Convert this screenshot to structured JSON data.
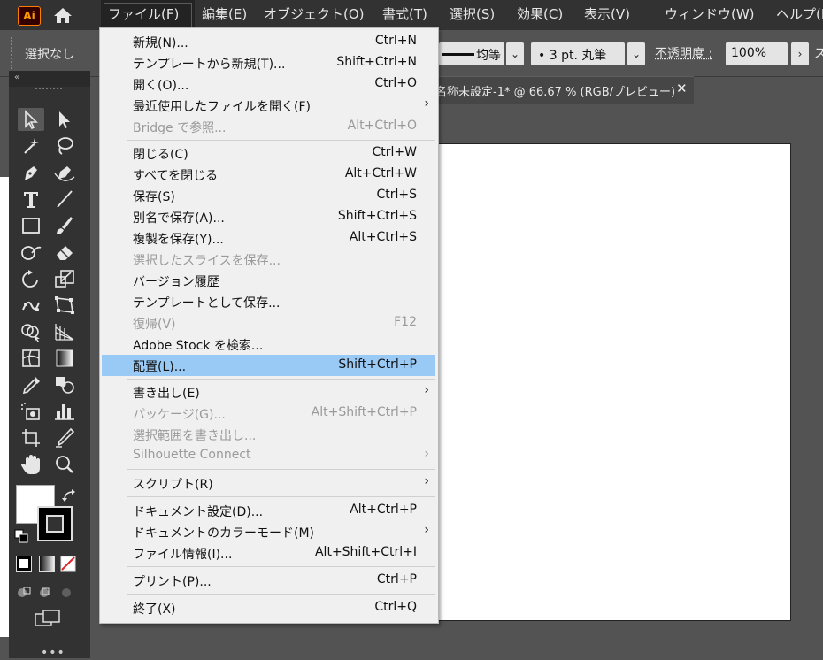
{
  "app": {
    "logo_text": "Ai",
    "home_icon": "home-icon"
  },
  "menubar": {
    "items": [
      "ファイル(F)",
      "編集(E)",
      "オブジェクト(O)",
      "書式(T)",
      "選択(S)",
      "効果(C)",
      "表示(V)",
      "ウィンドウ(W)",
      "ヘルプ(H)"
    ],
    "active": "ファイル(F)"
  },
  "control_bar": {
    "selection_label": "選択なし",
    "stroke_profile": "均等",
    "brush": "• 3 pt. 丸筆",
    "opacity_label": "不透明度 :",
    "opacity_value": "100%",
    "style_label": "ス"
  },
  "document_tab": {
    "title": "名称未設定-1* @ 66.67 % (RGB/プレビュー)",
    "close_icon": "close-icon"
  },
  "file_menu": {
    "items": [
      {
        "label": "新規(N)...",
        "shortcut": "Ctrl+N"
      },
      {
        "label": "テンプレートから新規(T)...",
        "shortcut": "Shift+Ctrl+N"
      },
      {
        "label": "開く(O)...",
        "shortcut": "Ctrl+O"
      },
      {
        "label": "最近使用したファイルを開く(F)",
        "shortcut": "",
        "submenu": true
      },
      {
        "label": "Bridge で参照...",
        "shortcut": "Alt+Ctrl+O",
        "disabled": true
      },
      {
        "label": "閉じる(C)",
        "shortcut": "Ctrl+W"
      },
      {
        "label": "すべてを閉じる",
        "shortcut": "Alt+Ctrl+W"
      },
      {
        "label": "保存(S)",
        "shortcut": "Ctrl+S"
      },
      {
        "label": "別名で保存(A)...",
        "shortcut": "Shift+Ctrl+S"
      },
      {
        "label": "複製を保存(Y)...",
        "shortcut": "Alt+Ctrl+S"
      },
      {
        "label": "選択したスライスを保存...",
        "shortcut": "",
        "disabled": true
      },
      {
        "label": "バージョン履歴",
        "shortcut": ""
      },
      {
        "label": "テンプレートとして保存...",
        "shortcut": ""
      },
      {
        "label": "復帰(V)",
        "shortcut": "F12",
        "disabled": true
      },
      {
        "label": "Adobe Stock を検索...",
        "shortcut": ""
      },
      {
        "label": "配置(L)...",
        "shortcut": "Shift+Ctrl+P",
        "highlighted": true
      },
      {
        "label": "書き出し(E)",
        "shortcut": "",
        "submenu": true
      },
      {
        "label": "パッケージ(G)...",
        "shortcut": "Alt+Shift+Ctrl+P",
        "disabled": true
      },
      {
        "label": "選択範囲を書き出し...",
        "shortcut": "",
        "disabled": true
      },
      {
        "label": "Silhouette Connect",
        "shortcut": "",
        "disabled": true,
        "submenu": true
      },
      {
        "label": "スクリプト(R)",
        "shortcut": "",
        "submenu": true
      },
      {
        "label": "ドキュメント設定(D)...",
        "shortcut": "Alt+Ctrl+P"
      },
      {
        "label": "ドキュメントのカラーモード(M)",
        "shortcut": "",
        "submenu": true
      },
      {
        "label": "ファイル情報(I)...",
        "shortcut": "Alt+Shift+Ctrl+I"
      },
      {
        "label": "プリント(P)...",
        "shortcut": "Ctrl+P"
      },
      {
        "label": "終了(X)",
        "shortcut": "Ctrl+Q"
      }
    ]
  },
  "toolbar": {
    "tools": [
      "selection-tool-icon",
      "direct-selection-tool-icon",
      "magic-wand-tool-icon",
      "lasso-tool-icon",
      "pen-tool-icon",
      "curvature-tool-icon",
      "type-tool-icon",
      "line-segment-tool-icon",
      "rectangle-tool-icon",
      "paintbrush-tool-icon",
      "shaper-tool-icon",
      "eraser-tool-icon",
      "rotate-tool-icon",
      "scale-tool-icon",
      "puppet-warp-tool-icon",
      "free-transform-tool-icon",
      "shape-builder-tool-icon",
      "perspective-grid-tool-icon",
      "mesh-tool-icon",
      "gradient-tool-icon",
      "eyedropper-tool-icon",
      "blend-tool-icon",
      "symbol-sprayer-tool-icon",
      "column-graph-tool-icon",
      "artboard-tool-icon",
      "slice-tool-icon",
      "hand-tool-icon",
      "zoom-tool-icon"
    ],
    "fill_color": "#ffffff",
    "stroke_color": "#000000"
  },
  "colors": {
    "chrome_dark": "#323232",
    "workspace": "#535353",
    "menu_bg": "#f0f0f0",
    "menu_highlight": "#99c9f5",
    "disabled_text": "#9a9a9a"
  }
}
